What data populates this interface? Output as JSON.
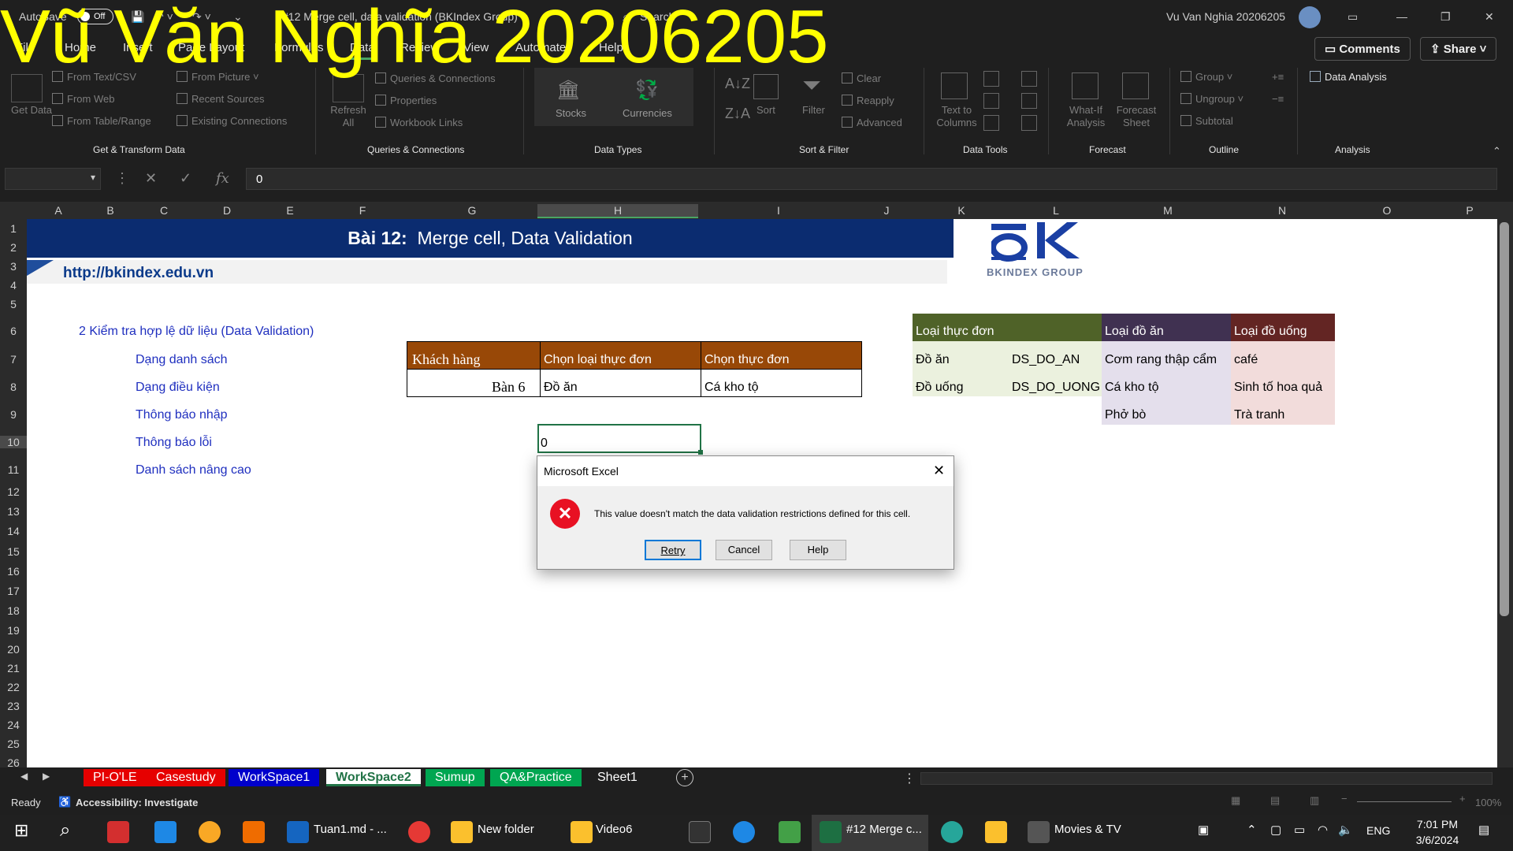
{
  "watermark": "Vũ Văn Nghĩa 20206205",
  "titlebar": {
    "autosave": "AutoSave",
    "autosave_state": "Off",
    "doc_title": "#12 Merge cell, data validation (BKIndex Group)",
    "search": "Search",
    "user": "Vu Van Nghia 20206205"
  },
  "tabs": [
    "File",
    "Home",
    "Insert",
    "Page Layout",
    "Formulas",
    "Data",
    "Review",
    "View",
    "Automate",
    "Help"
  ],
  "ribbon": {
    "comments": "Comments",
    "share": "Share",
    "get_data": "Get Data",
    "from_text": "From Text/CSV",
    "from_web": "From Web",
    "from_table": "From Table/Range",
    "from_picture": "From Picture",
    "recent_sources": "Recent Sources",
    "existing_connections": "Existing Connections",
    "refresh_all": "Refresh All",
    "queries_connections": "Queries & Connections",
    "properties": "Properties",
    "workbook_links": "Workbook Links",
    "stocks": "Stocks",
    "currencies": "Currencies",
    "sort": "Sort",
    "filter": "Filter",
    "clear": "Clear",
    "reapply": "Reapply",
    "advanced": "Advanced",
    "text_to_columns": "Text to Columns",
    "what_if": "What-If Analysis",
    "forecast_sheet": "Forecast Sheet",
    "group": "Group",
    "ungroup": "Ungroup",
    "subtotal": "Subtotal",
    "data_analysis": "Data Analysis",
    "groups": {
      "get_transform": "Get & Transform Data",
      "queries": "Queries & Connections",
      "data_types": "Data Types",
      "sort_filter": "Sort & Filter",
      "data_tools": "Data Tools",
      "forecast": "Forecast",
      "outline": "Outline",
      "analysis": "Analysis"
    }
  },
  "formula": {
    "value": "0",
    "fx": "fx"
  },
  "columns": [
    "A",
    "B",
    "C",
    "D",
    "E",
    "F",
    "G",
    "H",
    "I",
    "J",
    "K",
    "L",
    "M",
    "N",
    "O",
    "P"
  ],
  "rows": [
    "1",
    "2",
    "3",
    "4",
    "5",
    "6",
    "7",
    "8",
    "9",
    "10",
    "11",
    "12",
    "13",
    "14",
    "15",
    "16",
    "17",
    "18",
    "19",
    "20",
    "21",
    "22",
    "23",
    "24",
    "25",
    "26"
  ],
  "sheet": {
    "banner_title_bold": "Bài 12:",
    "banner_title": "Merge cell, Data Validation",
    "url": "http://bkindex.edu.vn",
    "logo_text": "BKINDEX GROUP",
    "section": "2  Kiểm tra hợp lệ dữ liệu (Data Validation)",
    "items": [
      "Dạng danh sách",
      "Dạng điều kiện",
      "Thông báo nhập",
      "Thông báo lỗi",
      "Danh sách nâng cao"
    ],
    "table": {
      "headers": [
        "Khách hàng",
        "Chọn loại thực đơn",
        "Chọn thực đơn"
      ],
      "row": [
        "Bàn 6",
        "Đồ ăn",
        "Cá kho tộ"
      ]
    },
    "active_cell_value": "0",
    "lookup": {
      "h1": "Loại thực đơn",
      "h2": "Loại đồ ăn",
      "h3": "Loại đồ uống",
      "c1": [
        "Đồ ăn",
        "Đồ uống"
      ],
      "c2": [
        "DS_DO_AN",
        "DS_DO_UONG"
      ],
      "c3": [
        "Cơm rang thập cẩm",
        "Cá kho tộ",
        "Phở bò"
      ],
      "c4": [
        "café",
        "Sinh tố hoa quả",
        "Trà tranh"
      ]
    }
  },
  "sheet_tabs": [
    {
      "label": "PI-O'LE",
      "color": "#e60000"
    },
    {
      "label": "Casestudy",
      "color": "#e60000"
    },
    {
      "label": "WorkSpace1",
      "color": "#0000cc"
    },
    {
      "label": "WorkSpace2",
      "color": "#ffffff"
    },
    {
      "label": "Sumup",
      "color": "#00a651"
    },
    {
      "label": "QA&Practice",
      "color": "#00a651"
    },
    {
      "label": "Sheet1",
      "color": "#1f1f1f"
    }
  ],
  "status": {
    "ready": "Ready",
    "accessibility": "Accessibility: Investigate",
    "zoom": "100%"
  },
  "dialog": {
    "title": "Microsoft Excel",
    "message": "This value doesn't match the data validation restrictions defined for this cell.",
    "retry": "Retry",
    "cancel": "Cancel",
    "help": "Help"
  },
  "taskbar": {
    "vscode": "Tuan1.md - ...",
    "folder": "New folder",
    "video": "Video6",
    "excel": "#12 Merge c...",
    "movies": "Movies & TV",
    "lang": "ENG",
    "time": "7:01 PM",
    "date": "3/6/2024"
  }
}
